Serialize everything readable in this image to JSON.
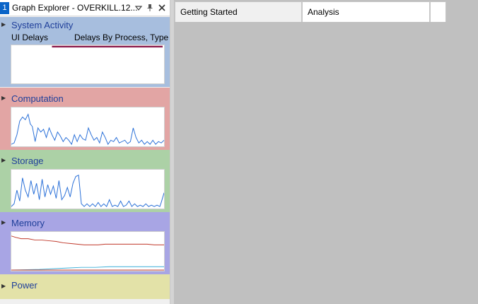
{
  "panel": {
    "number": "1",
    "title": "Graph Explorer - OVERKILL.12...",
    "icons": [
      "dropdown-icon",
      "pin-icon",
      "close-icon"
    ]
  },
  "sections": [
    {
      "title": "System Activity",
      "color": "#a7bede",
      "sublabels": [
        "UI Delays",
        "Delays By Process, Type"
      ]
    },
    {
      "title": "Computation",
      "color": "#e2a5a4"
    },
    {
      "title": "Storage",
      "color": "#acd1a6"
    },
    {
      "title": "Memory",
      "color": "#a8a5e4"
    },
    {
      "title": "Power",
      "color": "#e3e2a8"
    }
  ],
  "tabs": [
    {
      "label": "Getting Started",
      "active": false
    },
    {
      "label": "Analysis",
      "active": true
    },
    {
      "label": "",
      "active": false
    }
  ],
  "colors": {
    "series_blue": "#2a70d8",
    "series_red": "#c0392b",
    "series_maroon": "#8b1a4a",
    "series_cyan": "#3aaed8",
    "accent": "#0a64c8"
  }
}
